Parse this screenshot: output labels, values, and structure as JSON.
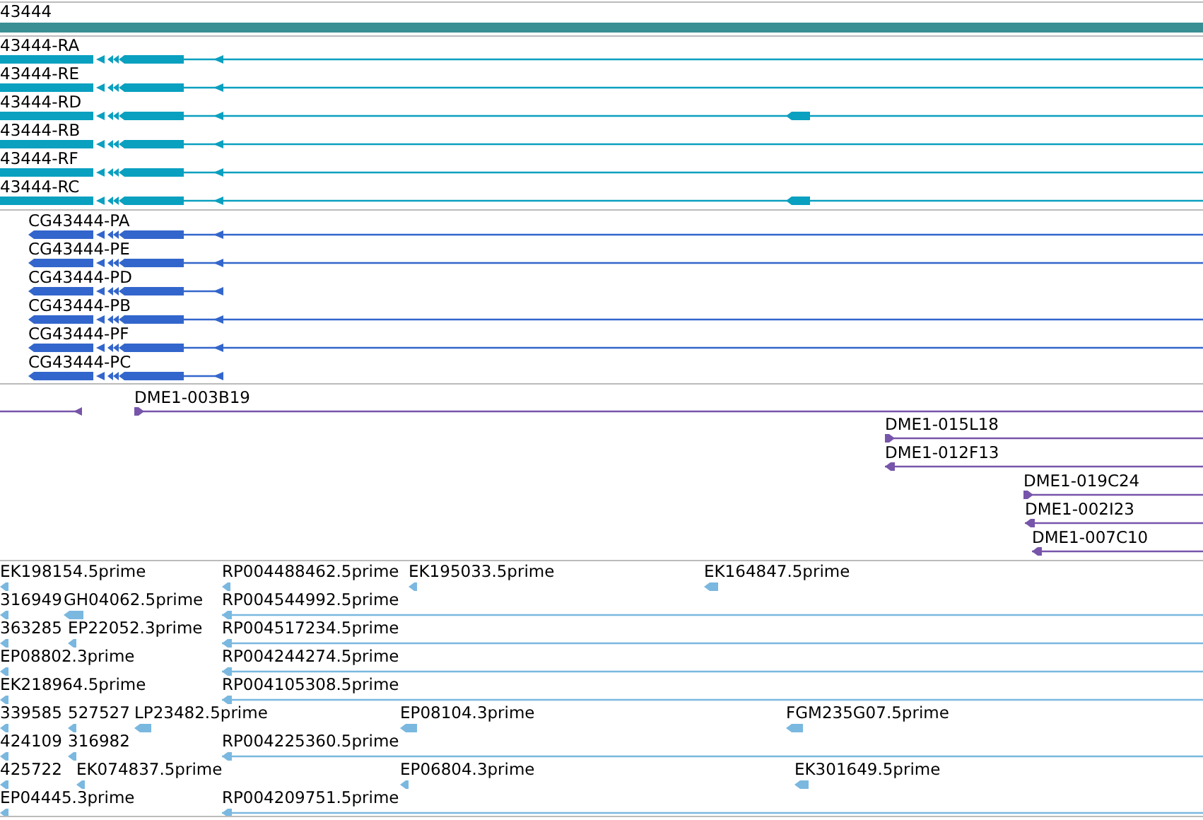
{
  "gene_track": {
    "label": "43444"
  },
  "transcripts": [
    {
      "label": "43444-RA"
    },
    {
      "label": "43444-RE"
    },
    {
      "label": "43444-RD"
    },
    {
      "label": "43444-RB"
    },
    {
      "label": "43444-RF"
    },
    {
      "label": "43444-RC"
    }
  ],
  "proteins": [
    {
      "label": "CG43444-PA"
    },
    {
      "label": "CG43444-PE"
    },
    {
      "label": "CG43444-PD"
    },
    {
      "label": "CG43444-PB"
    },
    {
      "label": "CG43444-PF"
    },
    {
      "label": "CG43444-PC"
    }
  ],
  "clones": [
    {
      "label": "DME1-003B19",
      "kind": "forward"
    },
    {
      "label": "DME1-015L18",
      "kind": "forward"
    },
    {
      "label": "DME1-012F13",
      "kind": "reverse"
    },
    {
      "label": "DME1-019C24",
      "kind": "forward"
    },
    {
      "label": "DME1-002I23",
      "kind": "reverse"
    },
    {
      "label": "DME1-007C10",
      "kind": "reverse"
    }
  ],
  "est_rows": [
    [
      {
        "label": "EK198154.5prime",
        "kind": "short"
      },
      {
        "label": "RP004488462.5prime",
        "kind": "short"
      },
      {
        "label": "EK195033.5prime",
        "kind": "short"
      },
      {
        "label": "EK164847.5prime",
        "kind": "short"
      }
    ],
    [
      {
        "label": "316949",
        "kind": "short"
      },
      {
        "label": "GH04062.5prime",
        "kind": "short"
      },
      {
        "label": "RP004544992.5prime",
        "kind": "long"
      }
    ],
    [
      {
        "label": "363285",
        "kind": "short"
      },
      {
        "label": "EP22052.3prime",
        "kind": "short"
      },
      {
        "label": "RP004517234.5prime",
        "kind": "long"
      }
    ],
    [
      {
        "label": "EP08802.3prime",
        "kind": "short"
      },
      {
        "label": "RP004244274.5prime",
        "kind": "long"
      }
    ],
    [
      {
        "label": "EK218964.5prime",
        "kind": "short"
      },
      {
        "label": "RP004105308.5prime",
        "kind": "long"
      }
    ],
    [
      {
        "label": "339585",
        "kind": "short"
      },
      {
        "label": "527527",
        "kind": "short"
      },
      {
        "label": "LP23482.5prime",
        "kind": "short"
      },
      {
        "label": "EP08104.3prime",
        "kind": "short"
      },
      {
        "label": "FGM235G07.5prime",
        "kind": "short"
      }
    ],
    [
      {
        "label": "424109",
        "kind": "short"
      },
      {
        "label": "316982",
        "kind": "short"
      },
      {
        "label": "RP004225360.5prime",
        "kind": "long"
      }
    ],
    [
      {
        "label": "425722",
        "kind": "short"
      },
      {
        "label": "EK074837.5prime",
        "kind": "short"
      },
      {
        "label": "EP06804.3prime",
        "kind": "short"
      },
      {
        "label": "EK301649.5prime",
        "kind": "short"
      }
    ],
    [
      {
        "label": "EP04445.3prime",
        "kind": "short"
      },
      {
        "label": "RP004209751.5prime",
        "kind": "long"
      }
    ]
  ]
}
